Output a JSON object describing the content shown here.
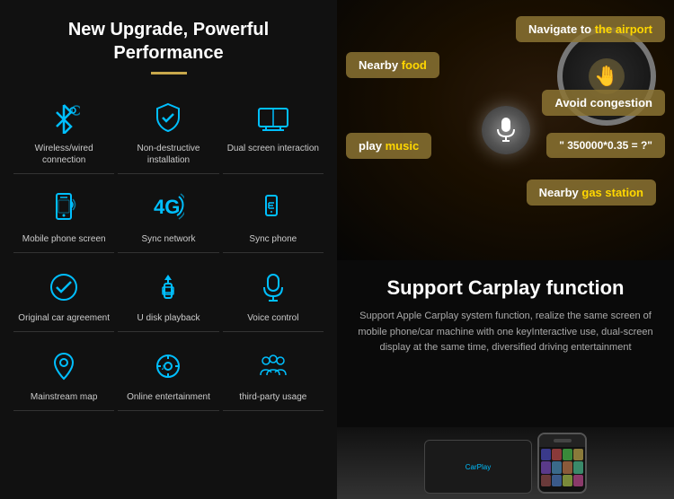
{
  "left": {
    "title": "New Upgrade, Powerful Performance",
    "features": [
      {
        "id": "bluetooth",
        "label": "Wireless/wired connection",
        "icon": "bluetooth"
      },
      {
        "id": "shield",
        "label": "Non-destructive installation",
        "icon": "shield"
      },
      {
        "id": "screen",
        "label": "Dual screen interaction",
        "icon": "screen"
      },
      {
        "id": "phone",
        "label": "Mobile phone screen",
        "icon": "phone"
      },
      {
        "id": "4g",
        "label": "Sync network",
        "icon": "4g"
      },
      {
        "id": "syncphone",
        "label": "Sync phone",
        "icon": "syncphone"
      },
      {
        "id": "check",
        "label": "Original car agreement",
        "icon": "check"
      },
      {
        "id": "usb",
        "label": "U disk playback",
        "icon": "usb"
      },
      {
        "id": "mic",
        "label": "Voice control",
        "icon": "mic"
      },
      {
        "id": "map",
        "label": "Mainstream map",
        "icon": "map"
      },
      {
        "id": "entertainment",
        "label": "Online entertainment",
        "icon": "entertainment"
      },
      {
        "id": "thirdparty",
        "label": "third-party usage",
        "icon": "thirdparty"
      }
    ]
  },
  "right": {
    "bubbles": [
      {
        "id": "navigate",
        "text": "Navigate to ",
        "highlight": "the airport",
        "position": "top-right"
      },
      {
        "id": "food",
        "text": "Nearby ",
        "highlight": "food",
        "position": "top-left"
      },
      {
        "id": "avoid",
        "text": "Avoid congestion",
        "position": "mid-right"
      },
      {
        "id": "play",
        "text": "play ",
        "highlight": "music",
        "position": "mid-left"
      },
      {
        "id": "calc",
        "text": "\" 350000*0.35 = ?\"",
        "position": "mid-right2"
      },
      {
        "id": "gas",
        "text": "Nearby ",
        "highlight": "gas station",
        "position": "bottom-right"
      }
    ],
    "carplay": {
      "title": "Support Carplay function",
      "description": "Support Apple Carplay system function, realize the same screen of mobile phone/car machine with one keyInteractive use, dual-screen display at the same time, diversified driving entertainment"
    }
  }
}
